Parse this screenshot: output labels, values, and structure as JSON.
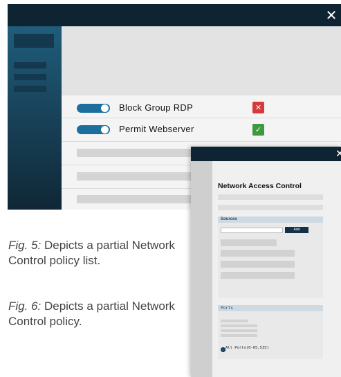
{
  "policy_list": {
    "close_glyph": "✕",
    "rows": [
      {
        "label": "Block Group RDP",
        "enabled": true,
        "status": "deny",
        "status_icon": "x-icon"
      },
      {
        "label": "Permit Webserver",
        "enabled": true,
        "status": "allow",
        "status_icon": "check-icon"
      }
    ]
  },
  "captions": [
    {
      "fig": "Fig. 5:",
      "text": " Depicts a partial Network Control policy list."
    },
    {
      "fig": "Fig. 6:",
      "text": " Depicts a partial Network Control policy."
    }
  ],
  "policy_detail": {
    "close_glyph": "✕",
    "title": "Network Access Control",
    "sources": {
      "header": "Sources",
      "add_label": "Add",
      "input_value": ""
    },
    "ports": {
      "header": "Ports",
      "option_label": "All Ports(0-65,535)",
      "option_selected": true
    }
  },
  "colors": {
    "titlebar": "#0e2433",
    "toggle_on": "#1c6e9c",
    "deny": "#d63a3a",
    "allow": "#3e9a3e"
  }
}
